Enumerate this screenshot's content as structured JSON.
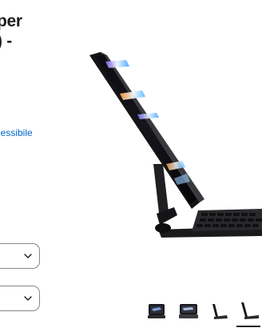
{
  "product": {
    "title_line1": "per",
    "title_line2": ") -"
  },
  "compat_link": "lessibile",
  "selectors": [
    {
      "value": ""
    },
    {
      "value": ""
    }
  ],
  "icons": {
    "select_chevron": "chevron-down-icon",
    "hero": "ipad-magic-keyboard-image",
    "gallery": [
      "thumbnail-image-1",
      "thumbnail-image-2",
      "thumbnail-image-3",
      "thumbnail-image-4"
    ]
  },
  "gallery": {
    "selected_index": 3
  },
  "colors": {
    "link": "#0066cc",
    "text": "#1d1d1f",
    "border": "#86868b"
  }
}
